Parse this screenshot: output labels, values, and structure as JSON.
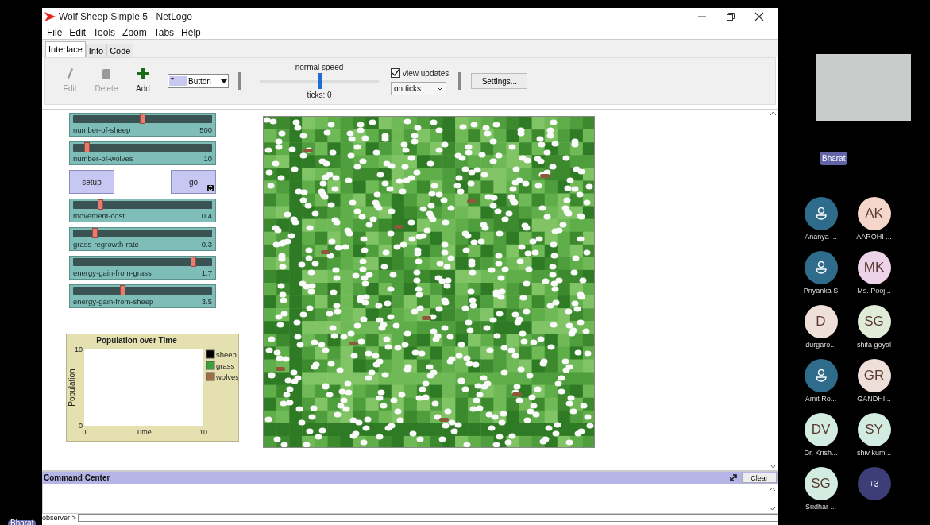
{
  "window": {
    "title": "Wolf Sheep Simple 5 - NetLogo"
  },
  "menu": [
    "File",
    "Edit",
    "Tools",
    "Zoom",
    "Tabs",
    "Help"
  ],
  "tabs": [
    {
      "label": "Interface",
      "selected": true
    },
    {
      "label": "Info",
      "selected": false
    },
    {
      "label": "Code",
      "selected": false
    }
  ],
  "toolbar": {
    "tools": [
      {
        "label": "Edit",
        "kind": "edit",
        "disabled": true
      },
      {
        "label": "Delete",
        "kind": "delete",
        "disabled": true
      },
      {
        "label": "Add",
        "kind": "add",
        "disabled": false
      }
    ],
    "widget_type": "Button",
    "speed_label": "normal speed",
    "speed": {
      "level": 0.5
    },
    "ticks": "ticks: 0",
    "view_updates": {
      "label": "view updates",
      "checked": true
    },
    "update_mode": "on ticks",
    "settings": "Settings..."
  },
  "widgets": [
    {
      "kind": "slider",
      "label": "number-of-sheep",
      "value": "500",
      "level": 0.5
    },
    {
      "kind": "slider",
      "label": "number-of-wolves",
      "value": "10",
      "level": 0.1
    },
    {
      "kind": "buttons",
      "buttons": [
        {
          "label": "setup",
          "forever": false
        },
        {
          "label": "go",
          "forever": true
        }
      ]
    },
    {
      "kind": "slider",
      "label": "movement-cost",
      "value": "0.4",
      "level": 0.2
    },
    {
      "kind": "slider",
      "label": "grass-regrowth-rate",
      "value": "0.3",
      "level": 0.16
    },
    {
      "kind": "slider",
      "label": "energy-gain-from-grass",
      "value": "1.7",
      "level": 0.87
    },
    {
      "kind": "slider",
      "label": "energy-gain-from-sheep",
      "value": "3.5",
      "level": 0.36
    }
  ],
  "plot": {
    "title": "Population over Time",
    "xlabel": "Time",
    "ylabel": "Population",
    "x_ticks": [
      "0",
      "10"
    ],
    "y_ticks": [
      "10",
      "0"
    ],
    "legend": [
      {
        "name": "sheep",
        "color": "#000000"
      },
      {
        "name": "grass",
        "color": "#3f9f3f"
      },
      {
        "name": "wolves",
        "color": "#9d6e48"
      }
    ]
  },
  "command_center": {
    "title": "Command Center",
    "clear": "Clear",
    "prompt": "observer >"
  },
  "meeting": {
    "speaker": "Bharat",
    "self_label": "Bharat",
    "participants": [
      {
        "kind": "icon",
        "name": "Ananya ...",
        "color": "#2f6b8a"
      },
      {
        "kind": "icon",
        "name": "Priyanka S",
        "color": "#2f6b8a"
      },
      {
        "kind": "initials",
        "initials": "D",
        "name": "durgaro...",
        "color": "#efdfd9"
      },
      {
        "kind": "icon",
        "name": "Amit Ro...",
        "color": "#2f6b8a"
      },
      {
        "kind": "initials",
        "initials": "DV",
        "name": "Dr. Krish...",
        "color": "#d3ece2"
      },
      {
        "kind": "initials",
        "initials": "SG",
        "name": "Sridhar ...",
        "color": "#d3ece2"
      },
      {
        "kind": "initials",
        "initials": "AK",
        "name": "AAROHI ...",
        "color": "#f6d6cb"
      },
      {
        "kind": "initials",
        "initials": "MK",
        "name": "Ms. Pooj...",
        "color": "#ecd3e8"
      },
      {
        "kind": "initials",
        "initials": "SG",
        "name": "shifa goyal",
        "color": "#e0ecd8"
      },
      {
        "kind": "initials",
        "initials": "GR",
        "name": "GANDHI...",
        "color": "#efdfd9"
      },
      {
        "kind": "initials",
        "initials": "SY",
        "name": "shiv kum...",
        "color": "#d3ece2"
      },
      {
        "kind": "more",
        "initials": "+3",
        "color": "#3d3d78"
      }
    ]
  }
}
